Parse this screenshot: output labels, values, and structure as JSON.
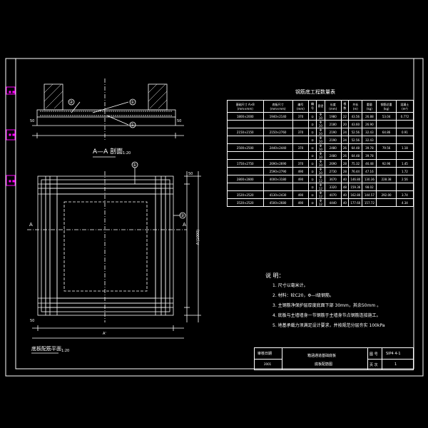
{
  "drawing": {
    "section_label": "A—A 剖面",
    "section_scale": "1:20",
    "plan_label": "底板配筋平面",
    "plan_scale": "1:20",
    "dims": {
      "d50_left": "50",
      "d50_right": "50",
      "a_prime": "A'",
      "a_len": "A'(1000)",
      "a_cut_left": "A",
      "a_cut_right": "A",
      "b50_top": "50",
      "b50_bot": "50"
    },
    "callouts": [
      "②",
      "①",
      "①",
      "②"
    ],
    "colors": {
      "background": "#000000",
      "lines": "#ffffff",
      "accent": "#ff00ff"
    }
  },
  "table": {
    "title": "钢筋底工程数量表",
    "headers": [
      "基础尺寸 A×B (mm×mm)",
      "底板尺寸 (mm×mm)",
      "编号 (mm)",
      "编号",
      "直径",
      "长度 (mm)",
      "根数",
      "共长 (m)",
      "重量 (kg)",
      "钢筋总重 (kg)",
      "混凝土 (m³)"
    ],
    "rows": [
      [
        "1800×2000",
        "1940×2140",
        "370",
        "①",
        "Φ 10",
        "1980",
        "22",
        "43.56",
        "26.88",
        "53.04",
        "0.772"
      ],
      [
        "",
        "",
        "",
        "②",
        "Φ 10",
        "2180",
        "20",
        "43.60",
        "26.90",
        "",
        ""
      ],
      [
        "2150×2150",
        "2150×2760",
        "370",
        "①",
        "Φ 10",
        "2190",
        "24",
        "52.56",
        "32.43",
        "64.86",
        "0.91"
      ],
      [
        "",
        "",
        "",
        "②",
        "Φ 10",
        "2190",
        "24",
        "52.56",
        "32.43",
        "",
        ""
      ],
      [
        "2500×2500",
        "2440×2440",
        "370",
        "①",
        "Φ 10",
        "2480",
        "26",
        "64.48",
        "39.78",
        "79.56",
        "1.18"
      ],
      [
        "",
        "",
        "",
        "②",
        "Φ 10",
        "2480",
        "26",
        "64.48",
        "39.78",
        "",
        ""
      ],
      [
        "1750×2750",
        "2690×2690",
        "370",
        "①",
        "Φ 10",
        "2690",
        "28",
        "75.32",
        "46.48",
        "92.96",
        "1.45"
      ],
      [
        "",
        "2590×2790",
        "490",
        "②",
        "Φ 10",
        "2730",
        "28",
        "76.44",
        "47.16",
        "",
        "1.72"
      ],
      [
        "2800×2800",
        "4000×3180",
        "490",
        "①",
        "Φ 12",
        "3670",
        "40",
        "146.80",
        "130.36",
        "228.38",
        "2.56"
      ],
      [
        "",
        "",
        "",
        "②",
        "Φ 12",
        "3320",
        "48",
        "159.36",
        "98.02",
        "",
        ""
      ],
      [
        "3520×2520",
        "4130×2430",
        "490",
        "①",
        "Φ 12",
        "4070",
        "40",
        "162.80",
        "144.57",
        "292.00",
        "3.74"
      ],
      [
        "3520×2520",
        "4500×2680",
        "490",
        "②",
        "Φ 12",
        "4440",
        "40",
        "177.60",
        "157.72",
        "",
        "4.34"
      ]
    ]
  },
  "notes": {
    "title": "说 明：",
    "items": [
      "1. 尺寸以毫米计。",
      "2. 材料：砼C20，Φ—Ⅰ级钢筋。",
      "3. 主钢筋净保护层厚度底面下部    30mm，其余50mm 。",
      "4. 底板与主墙墙身一节钢筋于主墙身节点钢筋连接施工。",
      "5. 地基承载力须满足设计要求，并按规范分层夯实    100kPa"
    ]
  },
  "title_block": {
    "left_label": "审核日期",
    "left_value": "2001",
    "middle_line1": "箱涵通道基础底板",
    "middle_line2": "底板配筋图",
    "drawing_no_label": "图 号",
    "drawing_no_value": "SIP4  4-1",
    "sheet_label": "页 次",
    "sheet_value": "1"
  }
}
